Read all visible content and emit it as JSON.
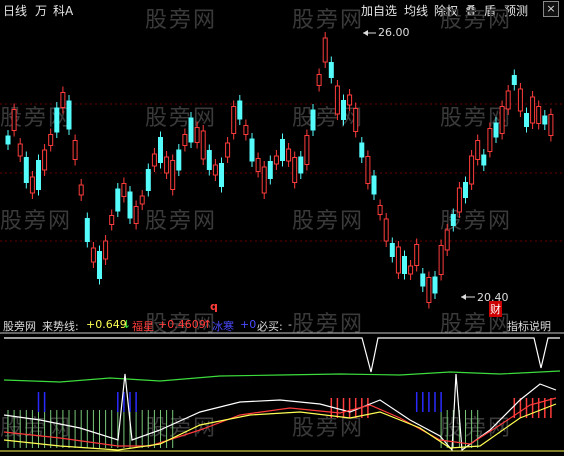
{
  "toolbar": {
    "left_items": [
      "日线",
      "万",
      "科A"
    ],
    "right_items": [
      "加自选",
      "均线",
      "除权",
      "叠",
      "盾",
      "预测"
    ],
    "close_symbol": "×"
  },
  "watermark": "股旁网",
  "price_panel": {
    "high_label": "26.00",
    "low_label": "20.40",
    "marker_q": "q",
    "marker_cai": "财"
  },
  "indicator_panel": {
    "site_label": "股旁网",
    "line1_name": "来势线:",
    "line1_value": "+0.649",
    "line1_arrow": "↓",
    "line2_name": "福星",
    "line2_value": "+0.4609",
    "line2_arrow": "↑",
    "line3_name": "冰寒",
    "line3_value": "+0",
    "line4_name": "必买:",
    "line4_value": "-",
    "explain_button": "指标说明"
  },
  "colors": {
    "up": "#ff3c3c",
    "down": "#54fcfc",
    "panel_line": "#c8c8c8",
    "yellow": "#ffff54",
    "white_line": "#ffffff",
    "green_line": "#3cdc3c",
    "blue_bars": "#2a2aff",
    "red_bars": "#ff3c3c",
    "green_bars": "#78c878"
  }
}
